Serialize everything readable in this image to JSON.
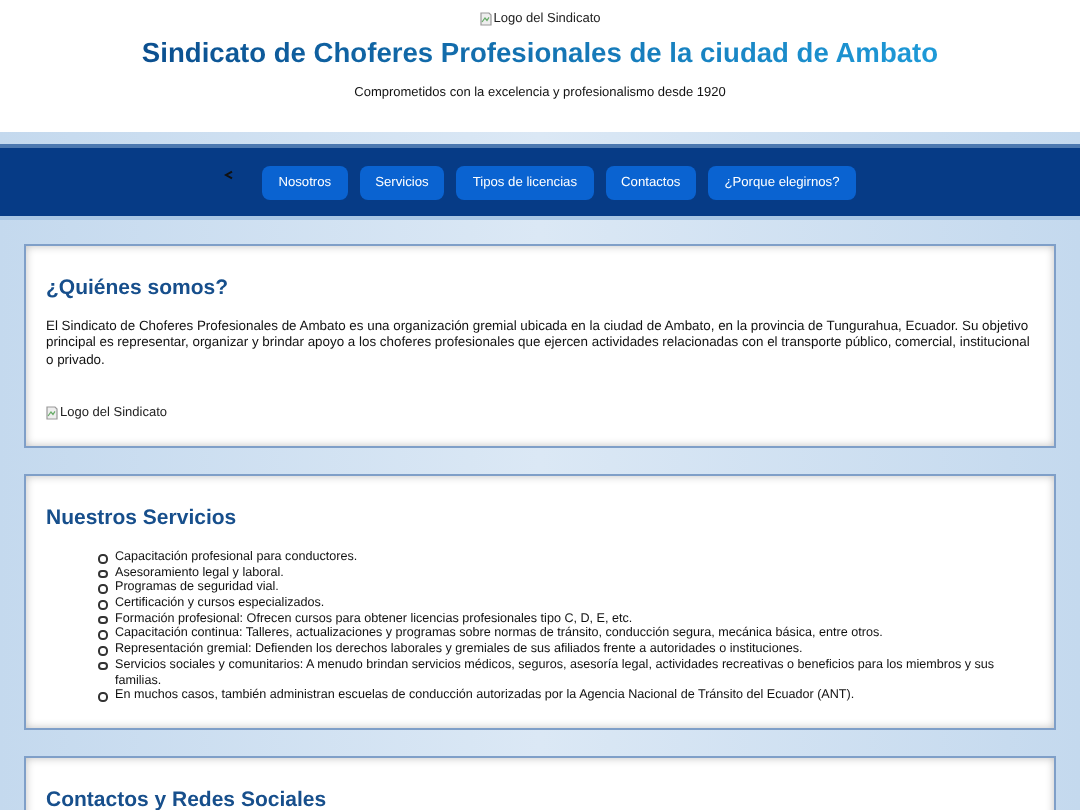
{
  "header": {
    "logo_alt": "Logo del Sindicato",
    "title": "Sindicato de Choferes Profesionales de la ciudad de Ambato",
    "tagline": "Comprometidos con la excelencia y profesionalismo desde 1920"
  },
  "nav": {
    "items": [
      "Nosotros",
      "Servicios",
      "Tipos de licencias",
      "Contactos",
      "¿Porque elegirnos?"
    ]
  },
  "about": {
    "heading": "¿Quiénes somos?",
    "text": "El Sindicato de Choferes Profesionales de Ambato es una organización gremial ubicada en la ciudad de Ambato, en la provincia de Tungurahua, Ecuador. Su objetivo principal es representar, organizar y brindar apoyo a los choferes profesionales que ejercen actividades relacionadas con el transporte público, comercial, institucional o privado.",
    "image_alt": "Logo del Sindicato"
  },
  "services": {
    "heading": "Nuestros Servicios",
    "items": [
      "Capacitación profesional para conductores.",
      "Asesoramiento legal y laboral.",
      "Programas de seguridad vial.",
      "Certificación y cursos especializados.",
      "Formación profesional: Ofrecen cursos para obtener licencias profesionales tipo C, D, E, etc.",
      "Capacitación continua: Talleres, actualizaciones y programas sobre normas de tránsito, conducción segura, mecánica básica, entre otros.",
      "Representación gremial: Defienden los derechos laborales y gremiales de sus afiliados frente a autoridades o instituciones.",
      "Servicios sociales y comunitarios: A menudo brindan servicios médicos, seguros, asesoría legal, actividades recreativas o beneficios para los miembros y sus familias.",
      "En muchos casos, también administran escuelas de conducción autorizadas por la Agencia Nacional de Tránsito del Ecuador (ANT)."
    ]
  },
  "contacts": {
    "heading": "Contactos y Redes Sociales"
  }
}
